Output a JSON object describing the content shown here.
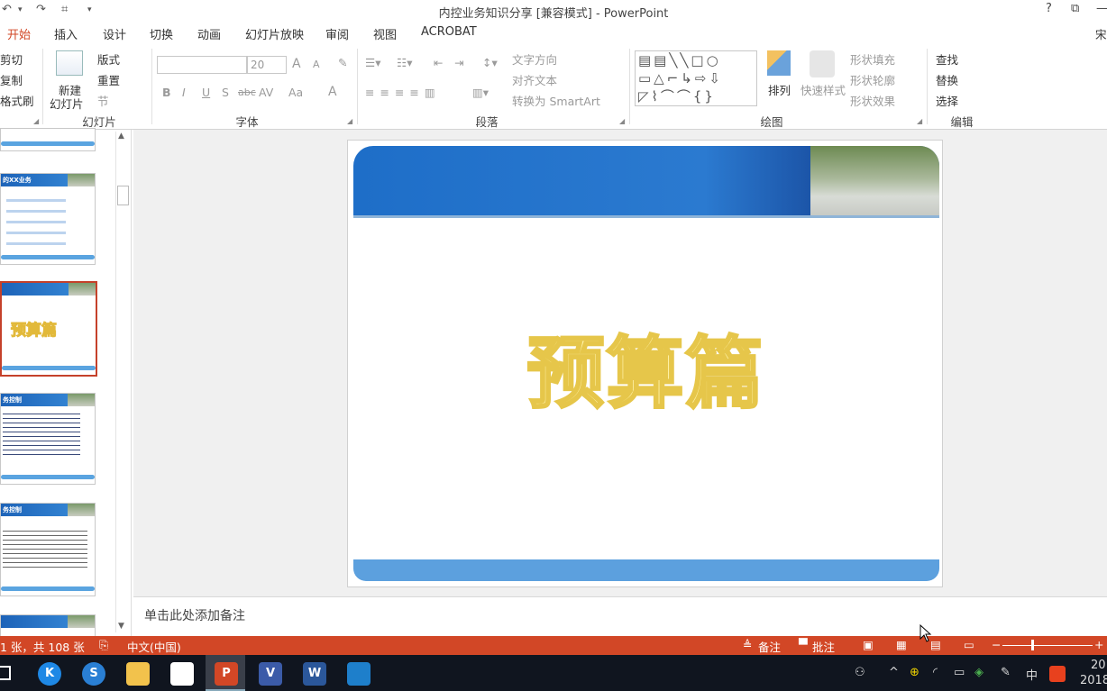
{
  "window": {
    "title": "内控业务知识分享 [兼容模式] - PowerPoint",
    "help": "?",
    "restore": "⧉",
    "minimize": "—"
  },
  "qat": {
    "undo": "↶",
    "redo": "↷",
    "present": "⌗",
    "more": "▾"
  },
  "tabs": [
    "开始",
    "插入",
    "设计",
    "切换",
    "动画",
    "幻灯片放映",
    "审阅",
    "视图",
    "ACROBAT"
  ],
  "ribbon": {
    "clipboard": {
      "cut": "剪切",
      "copy": "复制",
      "format_painter": "格式刷"
    },
    "slides": {
      "new_slide": "新建",
      "new_slide_2": "幻灯片",
      "layout": "版式",
      "reset": "重置",
      "section": "节",
      "group": "幻灯片"
    },
    "font": {
      "size": "20",
      "bold": "B",
      "italic": "I",
      "underline": "U",
      "shadow": "S",
      "strike": "abc",
      "spacing": "AV",
      "case": "Aa",
      "color": "A",
      "grow": "A",
      "shrink": "A",
      "group": "字体"
    },
    "paragraph": {
      "text_direction": "文字方向",
      "align_text": "对齐文本",
      "smartart": "转换为 SmartArt",
      "group": "段落"
    },
    "drawing": {
      "arrange": "排列",
      "quick_styles": "快速样式",
      "fill": "形状填充",
      "outline": "形状轮廓",
      "effects": "形状效果",
      "group": "绘图"
    },
    "editing": {
      "find": "查找",
      "replace": "替换",
      "select": "选择",
      "group": "编辑"
    },
    "partial_font": "宋"
  },
  "thumbnails": [
    {
      "title": "",
      "kind": "partial"
    },
    {
      "title": "的XX业务",
      "kind": "list"
    },
    {
      "title": "预算篇",
      "kind": "title"
    },
    {
      "title": "务控制",
      "kind": "text"
    },
    {
      "title": "务控制",
      "kind": "text2"
    },
    {
      "title": "",
      "kind": "partial"
    }
  ],
  "slide": {
    "title": "预算篇"
  },
  "notes": {
    "placeholder": "单击此处添加备注"
  },
  "status": {
    "slide_count": "1 张，共 108 张",
    "language": "中文(中国)",
    "notes": "备注",
    "comments": "批注"
  },
  "taskbar": {
    "apps": [
      "K",
      "S",
      "",
      "",
      "P",
      "V",
      "W",
      ""
    ],
    "tray_ime": "中",
    "clock": "20",
    "date": "2018"
  },
  "colors": {
    "accent": "#d24726",
    "taskbar": "#10151f",
    "banner": "#1e6ec8",
    "title_fill": "#fff2a8",
    "title_stroke": "#e6c64a"
  }
}
